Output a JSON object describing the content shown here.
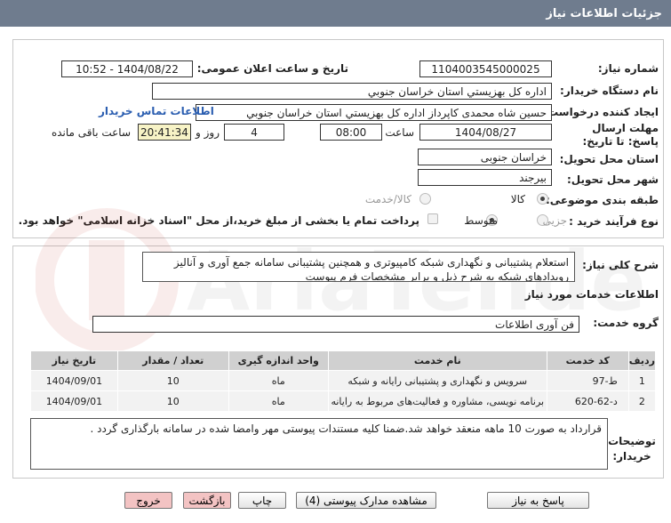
{
  "header": {
    "title": "جزئیات اطلاعات نیاز"
  },
  "fields": {
    "need_number_label": "شماره نیاز:",
    "need_number": "1104003545000025",
    "announce_label": "تاریخ و ساعت اعلان عمومی:",
    "announce_value": "1404/08/22 - 10:52",
    "buyer_org_label": "نام دستگاه خریدار:",
    "buyer_org": "اداره کل بهزيستي استان خراسان جنوبي",
    "creator_label": "ایجاد کننده درخواست:",
    "creator": "حسین شاه محمدی کاپرداز اداره کل بهزيستي استان خراسان جنوبي",
    "contact_link": "اطلاعات تماس خریدار",
    "deadline_label": "مهلت ارسال پاسخ: تا تاریخ:",
    "deadline_date": "1404/08/27",
    "time_label": "ساعت",
    "deadline_time": "08:00",
    "days": "4",
    "days_label": "روز و",
    "remaining_time": "20:41:34",
    "remaining_label": "ساعت باقی مانده",
    "province_label": "استان محل تحویل:",
    "province": "خراسان جنوبی",
    "city_label": "شهر محل تحویل:",
    "city": "بیرجند",
    "category_label": "طبقه بندی موضوعی:",
    "category_options": [
      "کالا",
      "کالا/خدمت"
    ],
    "process_label": "نوع فرآیند خرید :",
    "process_options": [
      "جزیی",
      "متوسط"
    ],
    "payment_note": "پرداخت تمام یا بخشی از مبلغ خرید،از محل \"اسناد خزانه اسلامی\" خواهد بود."
  },
  "summary": {
    "label": "شرح کلی نیاز:",
    "text": "استعلام پشتیبانی و نگهداری شبکه کامپیوتری و همچنین پشتیبانی سامانه جمع آوری و آنالیز رویدادهای شبکه  به شرح ذیل و برابر مشخصات فرم پیوست"
  },
  "services": {
    "section_title": "اطلاعات خدمات مورد نیاز",
    "group_label": "گروه خدمت:",
    "group_value": "فن آوری اطلاعات",
    "columns": [
      "ردیف",
      "کد خدمت",
      "نام خدمت",
      "واحد اندازه گیری",
      "تعداد / مقدار",
      "تاریخ نیاز"
    ],
    "rows": [
      [
        "1",
        "ط-97",
        "سرویس و نگهداری و پشتیبانی رایانه و شبکه",
        "ماه",
        "10",
        "1404/09/01"
      ],
      [
        "2",
        "د-62-620",
        "برنامه نویسی، مشاوره و فعالیت‌های مربوط به رایانه",
        "ماه",
        "10",
        "1404/09/01"
      ]
    ]
  },
  "buyer_notes": {
    "label": "توضیحات خریدار:",
    "text": "قرارداد به صورت 10 ماهه منعقد خواهد شد.ضمنا کلیه مستندات پیوستی مهر وامضا شده در سامانه بارگذاری گردد ."
  },
  "buttons": {
    "reply": "پاسخ به نیاز",
    "attachments": "مشاهده مدارک پیوستی (4)",
    "print": "چاپ",
    "back": "بازگشت",
    "exit": "خروج"
  },
  "watermark": {
    "text": "AriaTender.net"
  },
  "colors": {
    "header": "#6f7c8e",
    "highlight": "#f7f3c6",
    "link": "#2a5db0",
    "danger": "#f3c3c3"
  }
}
